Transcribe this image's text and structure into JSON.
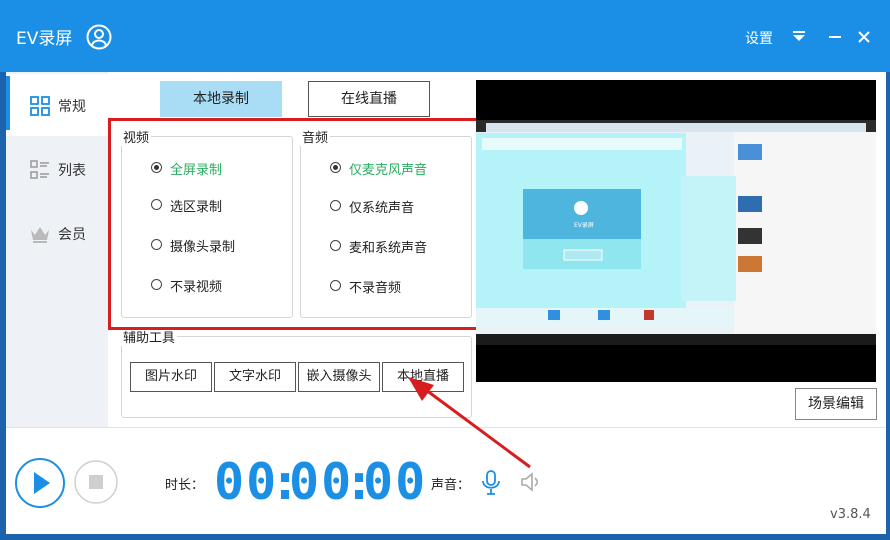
{
  "app": {
    "title": "EV录屏"
  },
  "titlebar": {
    "settings": "设置"
  },
  "sidebar": {
    "items": [
      {
        "label": "常规",
        "icon": "grid-icon"
      },
      {
        "label": "列表",
        "icon": "list-icon"
      },
      {
        "label": "会员",
        "icon": "crown-icon"
      }
    ]
  },
  "tabs": {
    "local": "本地录制",
    "live": "在线直播"
  },
  "video": {
    "title": "视频",
    "options": [
      "全屏录制",
      "选区录制",
      "摄像头录制",
      "不录视频"
    ],
    "selected": "全屏录制"
  },
  "audio": {
    "title": "音频",
    "options": [
      "仅麦克风声音",
      "仅系统声音",
      "麦和系统声音",
      "不录音频"
    ],
    "selected": "仅麦克风声音"
  },
  "tools": {
    "title": "辅助工具",
    "buttons": [
      "图片水印",
      "文字水印",
      "嵌入摄像头",
      "本地直播"
    ]
  },
  "scene_edit": "场景编辑",
  "preview_app_name": "EV录屏",
  "bottom": {
    "duration_label": "时长：",
    "time": {
      "hh": "00",
      "mm": "00",
      "ss": "00"
    },
    "sound_label": "声音：",
    "version": "v3.8.4"
  },
  "colors": {
    "accent": "#1a8fe5",
    "selected_green": "#27ae60",
    "highlight_red": "#d71d1d"
  }
}
